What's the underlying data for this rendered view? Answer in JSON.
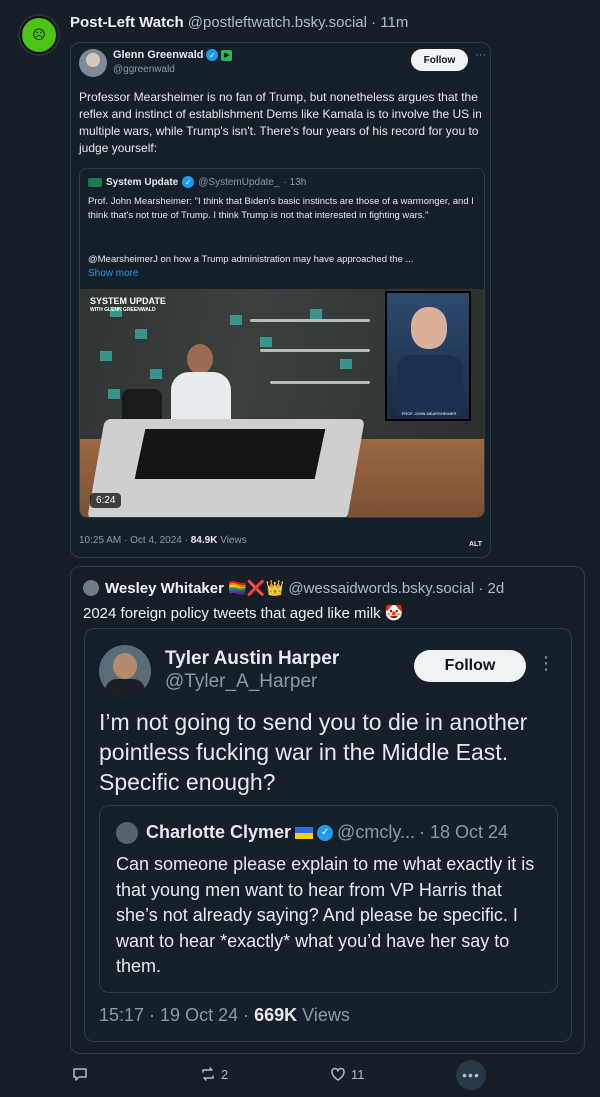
{
  "post": {
    "author_name": "Post-Left Watch",
    "author_handle": "@postleftwatch.bsky.social",
    "time": "· 11m"
  },
  "embed_glenn": {
    "name": "Glenn Greenwald",
    "handle": "@ggreenwald",
    "follow_label": "Follow",
    "more_label": "···",
    "text": "Professor Mearsheimer is no fan of Trump, but nonetheless argues that the reflex and instinct of establishment Dems like Kamala is to involve the US in multiple wars, while Trump's isn't. There's four years of his record for you to judge yourself:",
    "quote": {
      "name": "System Update",
      "handle": "@SystemUpdate_",
      "time": "· 13h",
      "text": "Prof. John Mearsheimer: \"I think that Biden's basic instincts are those of a warmonger, and I think that's not true of Trump. I think Trump is not that interested in fighting wars.\"",
      "text2": "@MearsheimerJ on how a Trump administration may have approached the ...",
      "show_more": "Show more",
      "video": {
        "brand": "SYSTEM UPDATE",
        "brand_sub": "WITH GLENN GREENWALD",
        "monitor_caption": "PROF. JOHN MEARSHEIMER",
        "duration": "6:24"
      }
    },
    "meta_time": "10:25 AM · Oct 4, 2024 ·",
    "meta_views_count": "84.9K",
    "meta_views_label": "Views",
    "alt": "ALT"
  },
  "quote_wesley": {
    "name": "Wesley Whitaker",
    "name_emoji": "🏳️‍🌈❌👑",
    "handle": "@wessaidwords.bsky.social",
    "time": "· 2d",
    "text": "2024 foreign policy tweets that aged like milk 🤡"
  },
  "embed_tyler": {
    "name": "Tyler Austin Harper",
    "handle": "@Tyler_A_Harper",
    "follow_label": "Follow",
    "more_label": "⋮",
    "text": "I’m not going to send you to die in another pointless fucking war in the Middle East. Specific enough?",
    "quote": {
      "name": "Charlotte Clymer",
      "handle": "@cmcly...",
      "time": "· 18 Oct 24",
      "text": "Can someone please explain to me what exactly it is that young men want to hear from VP Harris that she’s not already saying? And please be specific. I want to hear *exactly* what you’d have her say to them."
    },
    "meta_time": "15:17 · 19 Oct 24 ·",
    "meta_views_count": "669K",
    "meta_views_label": "Views"
  },
  "actions": {
    "reply_count": "",
    "repost_count": "2",
    "like_count": "11",
    "more_label": "•••"
  }
}
